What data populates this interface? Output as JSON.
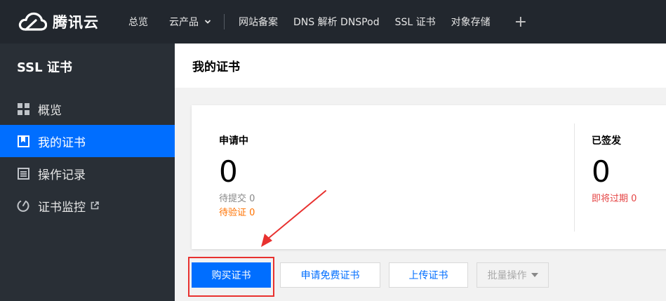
{
  "topbar": {
    "brand": "腾讯云",
    "nav": [
      {
        "label": "总览"
      },
      {
        "label": "云产品"
      },
      {
        "label": "网站备案"
      },
      {
        "label": "DNS 解析 DNSPod"
      },
      {
        "label": "SSL 证书"
      },
      {
        "label": "对象存储"
      }
    ],
    "plus": "+"
  },
  "sidebar": {
    "title": "SSL 证书",
    "items": [
      {
        "label": "概览",
        "icon": "grid-icon"
      },
      {
        "label": "我的证书",
        "icon": "certificate-icon",
        "active": true
      },
      {
        "label": "操作记录",
        "icon": "list-icon"
      },
      {
        "label": "证书监控",
        "icon": "monitor-gauge-icon",
        "external": true
      }
    ]
  },
  "main": {
    "title": "我的证书",
    "stats": {
      "applying": {
        "label": "申请中",
        "count": "0",
        "pending_submit": "待提交 0",
        "pending_verify": "待验证 0"
      },
      "issued": {
        "label": "已签发",
        "count": "0",
        "expiring": "即将过期 0"
      }
    },
    "buttons": {
      "buy": "购买证书",
      "apply_free": "申请免费证书",
      "upload": "上传证书",
      "batch": "批量操作"
    }
  },
  "colors": {
    "accent": "#006eff",
    "topbar": "#22272e",
    "sidebar": "#292f36",
    "warning": "#ff7200",
    "danger": "#e54545",
    "annotation": "#e8312f"
  }
}
